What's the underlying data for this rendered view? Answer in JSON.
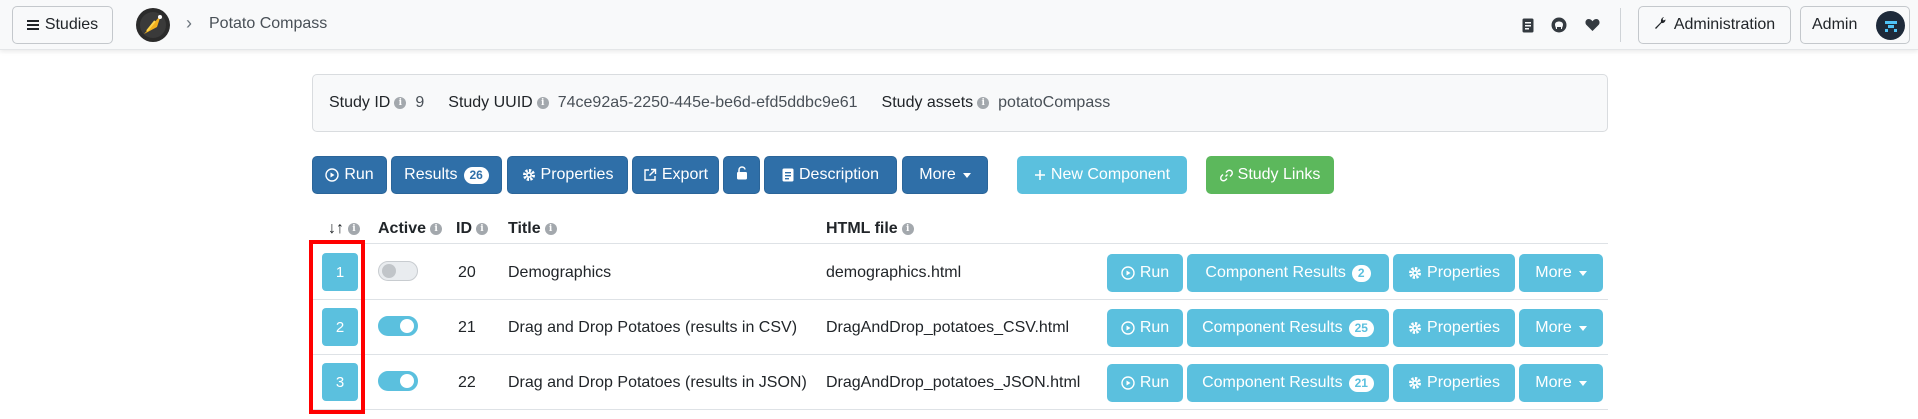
{
  "navbar": {
    "studies_label": "Studies",
    "breadcrumb_separator": "›",
    "study_title": "Potato Compass",
    "admin_label": "Administration",
    "user_label": "Admin"
  },
  "info": {
    "study_id_label": "Study ID",
    "study_id": "9",
    "study_uuid_label": "Study UUID",
    "study_uuid": "74ce92a5-2250-445e-be6d-efd5ddbc9e61",
    "study_assets_label": "Study assets",
    "study_assets": "potatoCompass"
  },
  "toolbar": {
    "run": "Run",
    "results": "Results",
    "results_count": "26",
    "properties": "Properties",
    "export": "Export",
    "description": "Description",
    "more": "More",
    "new_component": "New Component",
    "study_links": "Study Links"
  },
  "table": {
    "headers": {
      "position": "↓↑",
      "active": "Active",
      "id": "ID",
      "title": "Title",
      "html_file": "HTML file"
    },
    "rows": [
      {
        "position": "1",
        "active": false,
        "id": "20",
        "title": "Demographics",
        "html_file": "demographics.html",
        "run": "Run",
        "component_results": "Component Results",
        "results_count": "2",
        "properties": "Properties",
        "more": "More"
      },
      {
        "position": "2",
        "active": true,
        "id": "21",
        "title": "Drag and Drop Potatoes (results in CSV)",
        "html_file": "DragAndDrop_potatoes_CSV.html",
        "run": "Run",
        "component_results": "Component Results",
        "results_count": "25",
        "properties": "Properties",
        "more": "More"
      },
      {
        "position": "3",
        "active": true,
        "id": "22",
        "title": "Drag and Drop Potatoes (results in JSON)",
        "html_file": "DragAndDrop_potatoes_JSON.html",
        "run": "Run",
        "component_results": "Component Results",
        "results_count": "21",
        "properties": "Properties",
        "more": "More"
      }
    ]
  },
  "colors": {
    "primary": "#2f6fa8",
    "info": "#5bc0de",
    "success": "#5cb85c",
    "highlight": "#ff0000"
  },
  "icons": [
    "menu-icon",
    "logo-icon",
    "book-icon",
    "github-icon",
    "heart-icon",
    "wrench-icon",
    "play-icon",
    "gear-icon",
    "external-link-icon",
    "unlock-icon",
    "file-text-icon",
    "plus-icon",
    "link-icon",
    "info-icon"
  ]
}
